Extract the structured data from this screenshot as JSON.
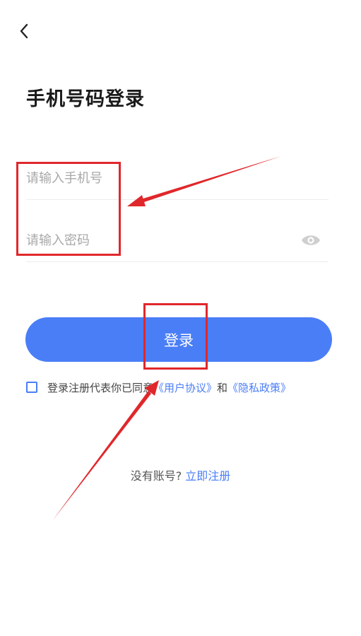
{
  "header": {
    "back_icon": "chevron-left-icon",
    "title": "手机号码登录"
  },
  "form": {
    "phone_placeholder": "请输入手机号",
    "password_placeholder": "请输入密码",
    "eye_icon": "eye-icon",
    "login_label": "登录"
  },
  "agreement": {
    "prefix": "登录注册代表你已同意",
    "user_agreement": "《用户协议》",
    "conjunction": "和",
    "privacy_policy": "《隐私政策》"
  },
  "register": {
    "prompt": "没有账号?",
    "link": "立即注册"
  },
  "colors": {
    "accent": "#4a7ef7",
    "annotation": "#e0272b"
  }
}
